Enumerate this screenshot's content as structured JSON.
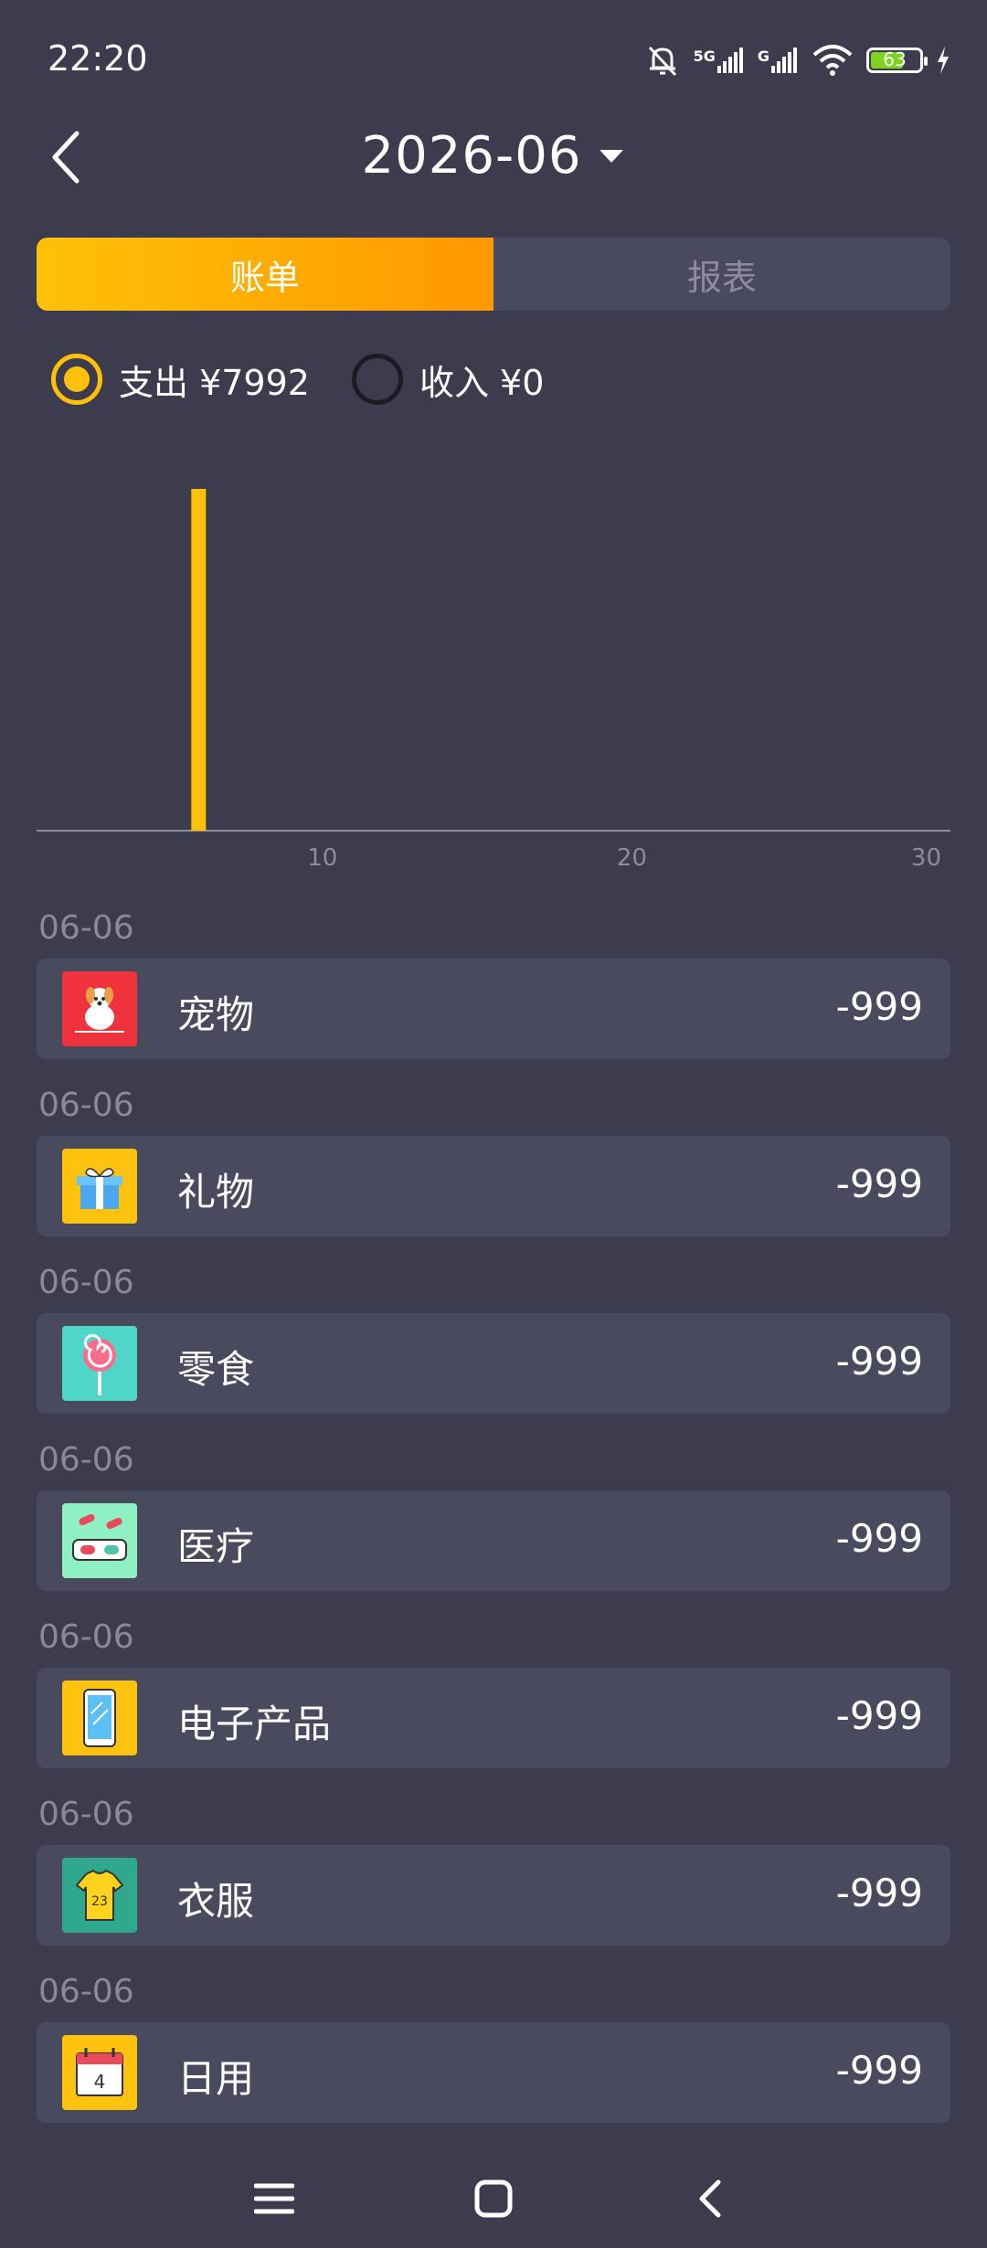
{
  "status_bar": {
    "time": "22:20",
    "battery": "63",
    "network": "5G",
    "network2": "G"
  },
  "header": {
    "month": "2026-06"
  },
  "tabs": [
    {
      "label": "账单",
      "active": true
    },
    {
      "label": "报表",
      "active": false
    }
  ],
  "toggle": {
    "expense_label": "支出 ¥7992",
    "income_label": "收入 ¥0",
    "selected": "expense"
  },
  "chart_data": {
    "type": "bar",
    "x": [
      6
    ],
    "values": [
      7992
    ],
    "xlim": [
      1,
      30
    ],
    "x_ticks": [
      "10",
      "20",
      "30"
    ],
    "color": "#ffc107"
  },
  "entries": [
    {
      "date": "06-06",
      "category": "宠物",
      "amount": "-999",
      "icon": "pet-dog-icon",
      "bg": "#f0323c"
    },
    {
      "date": "06-06",
      "category": "礼物",
      "amount": "-999",
      "icon": "gift-icon",
      "bg": "#ffc20e"
    },
    {
      "date": "06-06",
      "category": "零食",
      "amount": "-999",
      "icon": "lollipop-icon",
      "bg": "#4fd6c8"
    },
    {
      "date": "06-06",
      "category": "医疗",
      "amount": "-999",
      "icon": "medicine-icon",
      "bg": "#8ff0c4"
    },
    {
      "date": "06-06",
      "category": "电子产品",
      "amount": "-999",
      "icon": "phone-icon",
      "bg": "#ffc20e"
    },
    {
      "date": "06-06",
      "category": "衣服",
      "amount": "-999",
      "icon": "shirt-icon",
      "bg": "#2fa88e"
    },
    {
      "date": "06-06",
      "category": "日用",
      "amount": "-999",
      "icon": "calendar-icon",
      "bg": "#ffc20e"
    }
  ],
  "icon_texts": {
    "shirt_number": "23",
    "calendar_day": "4"
  }
}
